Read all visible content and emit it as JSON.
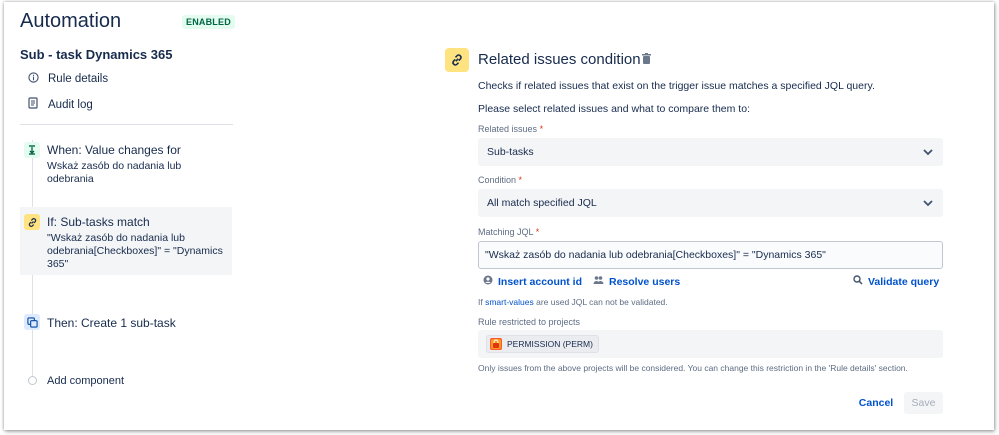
{
  "header": {
    "title": "Automation",
    "status_badge": "ENABLED"
  },
  "sidebar": {
    "rule_name": "Sub - task Dynamics 365",
    "links": [
      {
        "label": "Rule details",
        "icon": "info-icon"
      },
      {
        "label": "Audit log",
        "icon": "document-icon"
      }
    ]
  },
  "timeline": {
    "steps": [
      {
        "type": "trigger",
        "title": "When: Value changes for",
        "description": "Wskaż zasób do nadania lub odebrania",
        "icon": "trigger-icon",
        "color": "#e3fcef"
      },
      {
        "type": "condition",
        "title": "If: Sub-tasks match",
        "description": "\"Wskaż zasób do nadania lub odebrania[Checkboxes]\" = \"Dynamics 365\"",
        "icon": "link-icon",
        "color": "#ffe380"
      },
      {
        "type": "action",
        "title": "Then: Create 1 sub-task",
        "description": "",
        "icon": "subtask-icon",
        "color": "#deebff"
      }
    ],
    "add_label": "Add component"
  },
  "panel": {
    "title": "Related issues condition",
    "description": "Checks if related issues that exist on the trigger issue matches a specified JQL query.",
    "instruction": "Please select related issues and what to compare them to:",
    "related_issues": {
      "label": "Related issues",
      "required_mark": "*",
      "value": "Sub-tasks"
    },
    "condition": {
      "label": "Condition",
      "required_mark": "*",
      "value": "All match specified JQL"
    },
    "matching_jql": {
      "label": "Matching JQL",
      "required_mark": "*",
      "value": "\"Wskaż zasób do nadania lub odebrania[Checkboxes]\" = \"Dynamics 365\""
    },
    "actions": {
      "insert_account_id": "Insert account id",
      "resolve_users": "Resolve users",
      "validate_query": "Validate query"
    },
    "smart_values_note": {
      "prefix": "If ",
      "link": "smart-values",
      "suffix": " are used JQL can not be validated."
    },
    "restricted": {
      "label": "Rule restricted to projects",
      "project": "PERMISSION (PERM)",
      "note": "Only issues from the above projects will be considered. You can change this restriction in the 'Rule details' section."
    },
    "buttons": {
      "cancel": "Cancel",
      "save": "Save"
    }
  },
  "colors": {
    "link": "#0052cc",
    "enabled_bg": "#e3fcef",
    "enabled_text": "#006644",
    "condition_accent": "#ffe380"
  }
}
